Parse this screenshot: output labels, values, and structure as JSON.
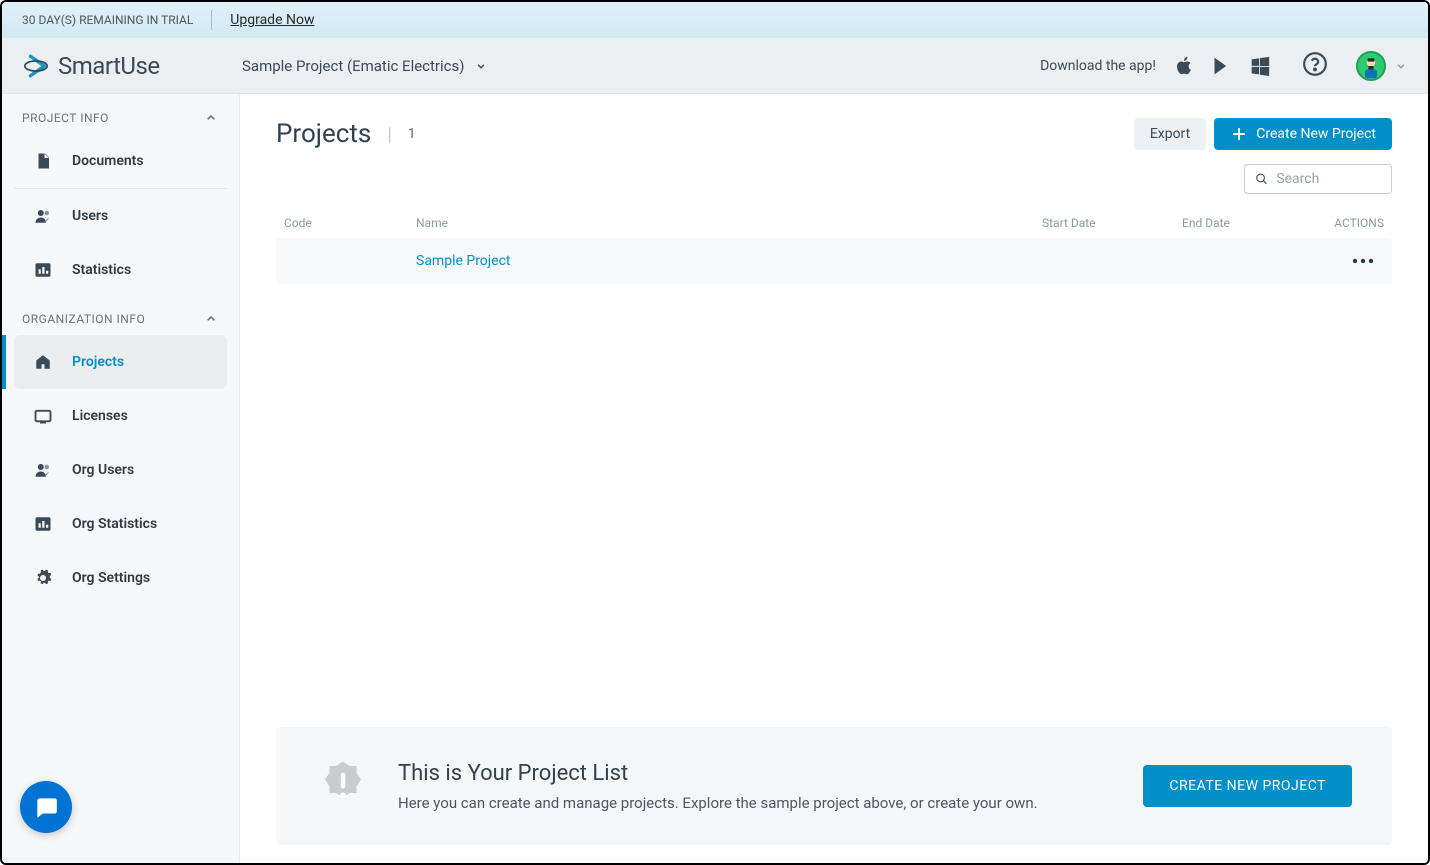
{
  "trial": {
    "remaining_text": "30 DAY(S) REMAINING IN TRIAL",
    "upgrade_label": "Upgrade Now"
  },
  "brand": "SmartUse",
  "project_selector": {
    "label": "Sample Project (Ematic Electrics)"
  },
  "download_text": "Download the app!",
  "sidebar": {
    "section1": "PROJECT INFO",
    "section2": "ORGANIZATION INFO",
    "documents": "Documents",
    "users": "Users",
    "statistics": "Statistics",
    "projects": "Projects",
    "licenses": "Licenses",
    "org_users": "Org Users",
    "org_statistics": "Org Statistics",
    "org_settings": "Org Settings"
  },
  "page": {
    "title": "Projects",
    "count": "1",
    "export_label": "Export",
    "create_label": "Create New Project",
    "search_placeholder": "Search"
  },
  "table": {
    "columns": {
      "code": "Code",
      "name": "Name",
      "start": "Start Date",
      "end": "End Date",
      "actions": "ACTIONS"
    },
    "row": {
      "code": "",
      "name": "Sample Project",
      "start": "",
      "end": ""
    }
  },
  "onboard": {
    "title": "This is Your Project List",
    "body": "Here you can create and manage projects. Explore the sample project above, or create your own.",
    "button": "CREATE NEW PROJECT"
  }
}
